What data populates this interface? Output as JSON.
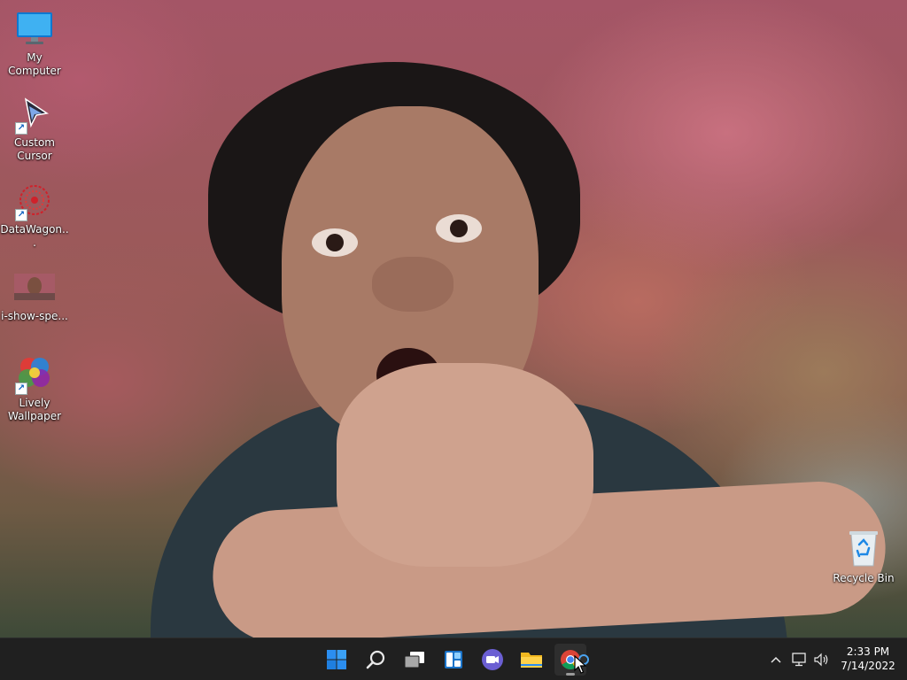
{
  "desktop": {
    "icons": [
      {
        "label": "My Computer",
        "icon": "monitor-icon",
        "shortcut": false
      },
      {
        "label": "Custom Cursor",
        "icon": "cursor-arrow-icon",
        "shortcut": true
      },
      {
        "label": "DataWagon...",
        "icon": "red-circle-logo-icon",
        "shortcut": true
      },
      {
        "label": "i-show-spe...",
        "icon": "image-thumbnail-icon",
        "shortcut": false
      },
      {
        "label": "Lively Wallpaper",
        "icon": "lively-wallpaper-icon",
        "shortcut": true
      },
      {
        "label": "Recycle Bin",
        "icon": "recycle-bin-icon",
        "shortcut": false
      }
    ]
  },
  "taskbar": {
    "pinned": [
      {
        "name": "start",
        "icon": "windows-start-icon"
      },
      {
        "name": "search",
        "icon": "search-icon"
      },
      {
        "name": "task-view",
        "icon": "task-view-icon"
      },
      {
        "name": "widgets",
        "icon": "widgets-icon"
      },
      {
        "name": "teams-chat",
        "icon": "video-chat-icon"
      },
      {
        "name": "file-explorer",
        "icon": "folder-icon"
      },
      {
        "name": "chrome",
        "icon": "chrome-icon",
        "active": true
      }
    ],
    "tray": {
      "icons": [
        "chevron-up-icon",
        "network-icon",
        "volume-icon"
      ]
    },
    "clock": {
      "time": "2:33 PM",
      "date": "7/14/2022"
    }
  },
  "colors": {
    "taskbar_bg": "#202020",
    "windows_blue": "#0078d4",
    "icon_label_text": "#ffffff"
  }
}
